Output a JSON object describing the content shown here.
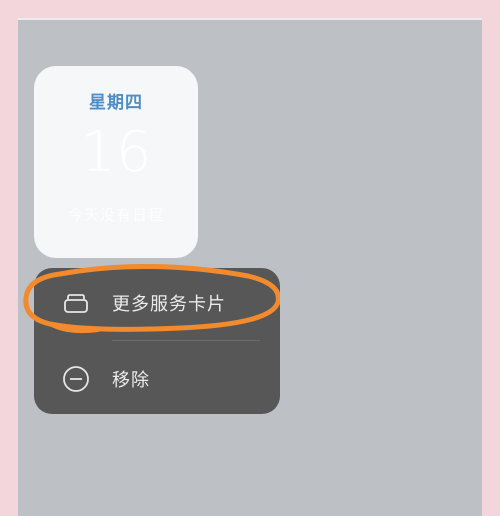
{
  "calendar_card": {
    "weekday": "星期四",
    "day": "16",
    "note": "今天没有日程"
  },
  "context_menu": {
    "items": [
      {
        "label": "更多服务卡片",
        "icon": "cards-stack-icon"
      },
      {
        "label": "移除",
        "icon": "remove-circle-icon"
      }
    ]
  },
  "annotation": {
    "highlight_color": "#f28a2e"
  },
  "colors": {
    "outer_background": "#f3d5dc",
    "screen_background": "#bdc1c5",
    "menu_background": "#575757",
    "weekday_accent": "#4e8ec6"
  }
}
